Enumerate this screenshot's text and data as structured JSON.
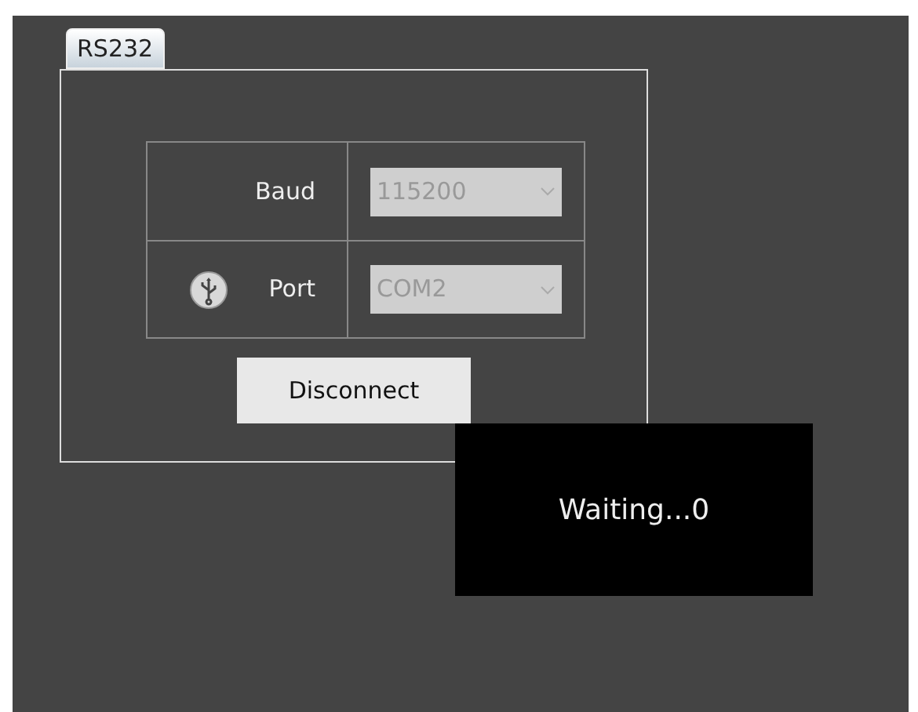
{
  "tabs": [
    {
      "label": "RS232",
      "selected": true
    }
  ],
  "fields": [
    {
      "label": "Baud",
      "value": "115200",
      "disabled": true,
      "kind": "plain"
    },
    {
      "label": "Port",
      "value": "COM2",
      "disabled": true,
      "kind": "usb"
    }
  ],
  "button": "Disconnect",
  "overlay": {
    "message": "Waiting...0"
  }
}
